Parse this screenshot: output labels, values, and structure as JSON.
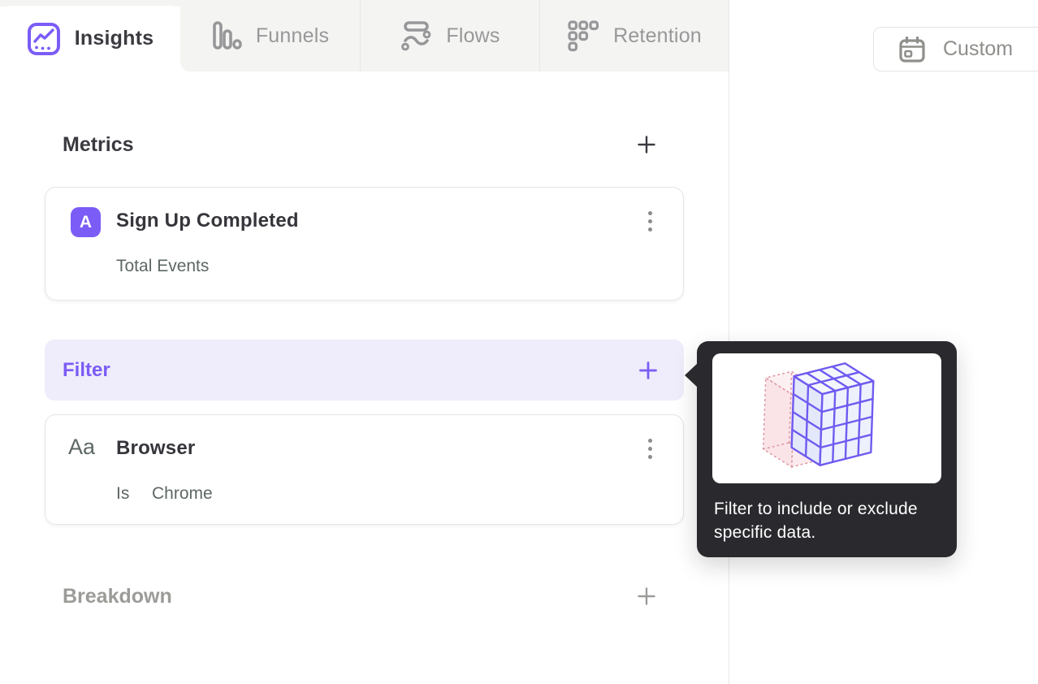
{
  "tabs": [
    {
      "label": "Insights",
      "icon": "line-chart-icon",
      "active": true
    },
    {
      "label": "Funnels",
      "icon": "funnel-bars-icon",
      "active": false
    },
    {
      "label": "Flows",
      "icon": "flow-wave-icon",
      "active": false
    },
    {
      "label": "Retention",
      "icon": "retention-dots-icon",
      "active": false
    }
  ],
  "toolbar": {
    "date_range_label": "Custom",
    "date_range_icon": "calendar-icon"
  },
  "sections": {
    "metrics": {
      "title": "Metrics",
      "add_icon": "plus-icon"
    },
    "filter": {
      "title": "Filter",
      "add_icon": "plus-icon"
    },
    "breakdown": {
      "title": "Breakdown",
      "add_icon": "plus-icon"
    }
  },
  "metric_card": {
    "badge": "A",
    "title": "Sign Up Completed",
    "subtitle": "Total Events",
    "menu_icon": "kebab-menu-icon"
  },
  "filter_card": {
    "type_label": "Aa",
    "title": "Browser",
    "operator": "Is",
    "value": "Chrome",
    "menu_icon": "kebab-menu-icon"
  },
  "tooltip": {
    "text": "Filter to include or exclude specific data.",
    "illustration": "filter-cube-illustration"
  },
  "colors": {
    "accent_purple": "#7b5cf6",
    "filter_row_bg": "#efedfc",
    "tooltip_bg": "#2a2a2e",
    "inactive_tab_bg": "#f4f4f2",
    "illustration_purple": "#6f5af0",
    "illustration_pink": "#dd97a2"
  }
}
